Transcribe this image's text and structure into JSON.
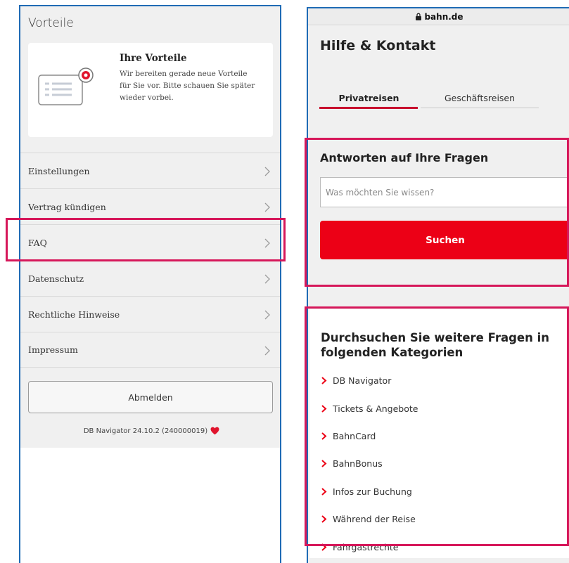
{
  "left_panel": {
    "heading": "Vorteile",
    "card": {
      "title": "Ihre Vorteile",
      "text": "Wir bereiten gerade neue Vorteile für Sie vor. Bitte schauen Sie später wieder vorbei.",
      "illustration_icon": "benefits-card-icon"
    },
    "menu": [
      {
        "label": "Einstellungen"
      },
      {
        "label": "Vertrag kündigen"
      },
      {
        "label": "FAQ"
      },
      {
        "label": "Datenschutz"
      },
      {
        "label": "Rechtliche Hinweise"
      },
      {
        "label": "Impressum"
      }
    ],
    "logout_label": "Abmelden",
    "version_text": "DB Navigator 24.10.2 (240000019)",
    "heart_icon": "heart-icon"
  },
  "right_panel": {
    "url": "bahn.de",
    "title": "Hilfe & Kontakt",
    "tabs": [
      {
        "label": "Privatreisen",
        "active": true
      },
      {
        "label": "Geschäftsreisen",
        "active": false
      }
    ],
    "answers": {
      "title": "Antworten auf Ihre Fragen",
      "placeholder": "Was möchten Sie wissen?",
      "button_label": "Suchen"
    },
    "categories": {
      "title": "Durchsuchen Sie weitere Fragen in folgenden Kategorien",
      "items": [
        {
          "label": "DB Navigator"
        },
        {
          "label": "Tickets & Angebote"
        },
        {
          "label": "BahnCard"
        },
        {
          "label": "BahnBonus"
        },
        {
          "label": "Infos zur Buchung"
        },
        {
          "label": "Während der Reise"
        },
        {
          "label": "Fahrgastrechte"
        }
      ]
    }
  },
  "colors": {
    "db_red": "#ec0016",
    "tab_red": "#c8102e",
    "highlight": "#d6175a",
    "frame_blue": "#1f6bb5"
  }
}
